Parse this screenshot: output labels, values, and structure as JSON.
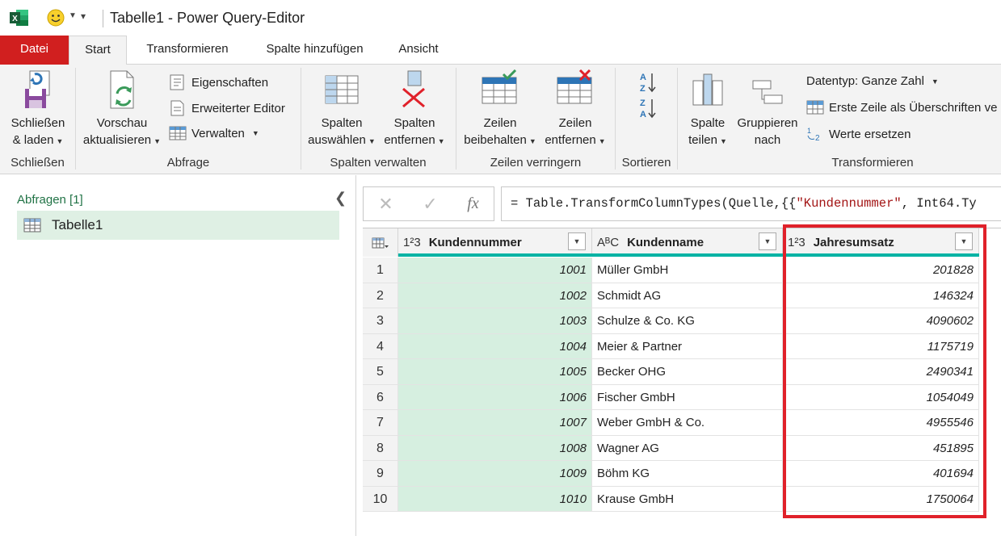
{
  "window": {
    "title": "Tabelle1 - Power Query-Editor"
  },
  "tabs": [
    {
      "label": "Datei"
    },
    {
      "label": "Start"
    },
    {
      "label": "Transformieren"
    },
    {
      "label": "Spalte hinzufügen"
    },
    {
      "label": "Ansicht"
    }
  ],
  "ribbon": {
    "schliessen": {
      "line1": "Schließen",
      "line2": "& laden",
      "group": "Schließen"
    },
    "abfrage": {
      "vorschau_line1": "Vorschau",
      "vorschau_line2": "aktualisieren",
      "eigenschaften": "Eigenschaften",
      "erweiterter_editor": "Erweiterter Editor",
      "verwalten": "Verwalten",
      "group": "Abfrage"
    },
    "spalten": {
      "auswaehlen_line1": "Spalten",
      "auswaehlen_line2": "auswählen",
      "entfernen_line1": "Spalten",
      "entfernen_line2": "entfernen",
      "group": "Spalten verwalten"
    },
    "zeilen": {
      "beibehalten_line1": "Zeilen",
      "beibehalten_line2": "beibehalten",
      "entfernen_line1": "Zeilen",
      "entfernen_line2": "entfernen",
      "group": "Zeilen verringern"
    },
    "sortieren": {
      "group": "Sortieren"
    },
    "transformieren": {
      "teilen_line1": "Spalte",
      "teilen_line2": "teilen",
      "gruppieren_line1": "Gruppieren",
      "gruppieren_line2": "nach",
      "datentyp": "Datentyp: Ganze Zahl",
      "erste_zeile": "Erste Zeile als Überschriften ve",
      "werte_ersetzen": "Werte ersetzen",
      "group": "Transformieren"
    }
  },
  "queries": {
    "title": "Abfragen [1]",
    "items": [
      {
        "label": "Tabelle1"
      }
    ]
  },
  "formula": {
    "prefix": "= Table.TransformColumnTypes(Quelle,{{",
    "string": "\"Kundennummer\"",
    "suffix": ", Int64.Ty",
    "fx": "fx"
  },
  "table": {
    "columns": [
      {
        "type": "1²3",
        "name": "Kundennummer"
      },
      {
        "type": "AᴮC",
        "name": "Kundenname"
      },
      {
        "type": "1²3",
        "name": "Jahresumsatz"
      }
    ],
    "rows": [
      {
        "idx": "1",
        "kundennummer": "1001",
        "kundenname": "Müller GmbH",
        "jahresumsatz": "201828"
      },
      {
        "idx": "2",
        "kundennummer": "1002",
        "kundenname": "Schmidt AG",
        "jahresumsatz": "146324"
      },
      {
        "idx": "3",
        "kundennummer": "1003",
        "kundenname": "Schulze & Co. KG",
        "jahresumsatz": "4090602"
      },
      {
        "idx": "4",
        "kundennummer": "1004",
        "kundenname": "Meier & Partner",
        "jahresumsatz": "1175719"
      },
      {
        "idx": "5",
        "kundennummer": "1005",
        "kundenname": "Becker OHG",
        "jahresumsatz": "2490341"
      },
      {
        "idx": "6",
        "kundennummer": "1006",
        "kundenname": "Fischer GmbH",
        "jahresumsatz": "1054049"
      },
      {
        "idx": "7",
        "kundennummer": "1007",
        "kundenname": "Weber GmbH & Co.",
        "jahresumsatz": "4955546"
      },
      {
        "idx": "8",
        "kundennummer": "1008",
        "kundenname": "Wagner AG",
        "jahresumsatz": "451895"
      },
      {
        "idx": "9",
        "kundennummer": "1009",
        "kundenname": "Böhm KG",
        "jahresumsatz": "401694"
      },
      {
        "idx": "10",
        "kundennummer": "1010",
        "kundenname": "Krause GmbH",
        "jahresumsatz": "1750064"
      }
    ]
  },
  "colors": {
    "excel_green": "#217346",
    "datei_red": "#d11f1f",
    "highlight_red": "#e0212a",
    "quality_teal": "#00b3a4"
  }
}
